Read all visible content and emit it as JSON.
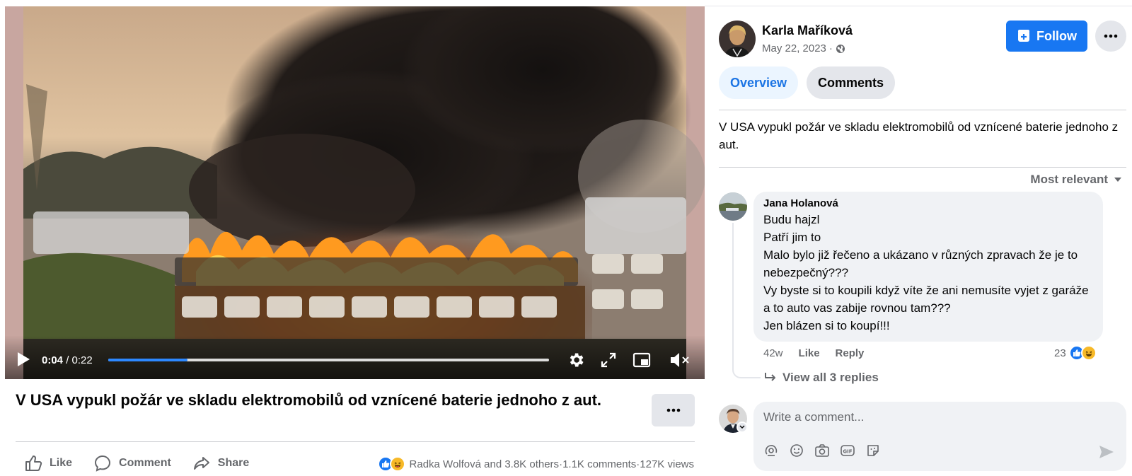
{
  "video": {
    "current_time": "0:04",
    "separator": " / ",
    "duration": "0:22",
    "progress_fraction": 0.18
  },
  "post": {
    "title": "V USA vypukl požár ve skladu elektromobilů od vznícené baterie jednoho z aut.",
    "actions": {
      "like": "Like",
      "comment": "Comment",
      "share": "Share"
    },
    "stats": {
      "reactors": "Radka Wolfová and 3.8K others",
      "comments": "1.1K comments",
      "views": "127K views",
      "separator": " · "
    }
  },
  "author": {
    "name": "Karla Maříková",
    "date": "May 22, 2023",
    "dot": "·",
    "visibility_icon": "globe-icon"
  },
  "buttons": {
    "follow": "Follow"
  },
  "tabs": [
    {
      "label": "Overview",
      "active": true
    },
    {
      "label": "Comments",
      "active": false
    }
  ],
  "description": "V USA vypukl požár ve skladu elektromobilů od vznícené baterie jednoho z aut.",
  "sort_label": "Most relevant",
  "comment": {
    "author": "Jana Holanová",
    "lines": [
      "Budu hajzl",
      "Patří jim to",
      "Malo bylo již řečeno a ukázano v různých zpravach že je to nebezpečný???",
      "Vy byste si to koupili když víte že ani nemusíte vyjet z garáže a to auto vas zabije rovnou tam???",
      "Jen blázen si to koupí!!!"
    ],
    "age": "42w",
    "like": "Like",
    "reply": "Reply",
    "reaction_count": "23",
    "view_replies": "View all 3 replies"
  },
  "composer": {
    "placeholder": "Write a comment..."
  },
  "colors": {
    "brand_blue": "#1877f2",
    "active_tab_bg": "#ebf5ff",
    "active_tab_text": "#1b74e4",
    "secondary_text": "#65676b",
    "bubble_bg": "#f0f2f5",
    "button_grey": "#e4e6eb"
  }
}
